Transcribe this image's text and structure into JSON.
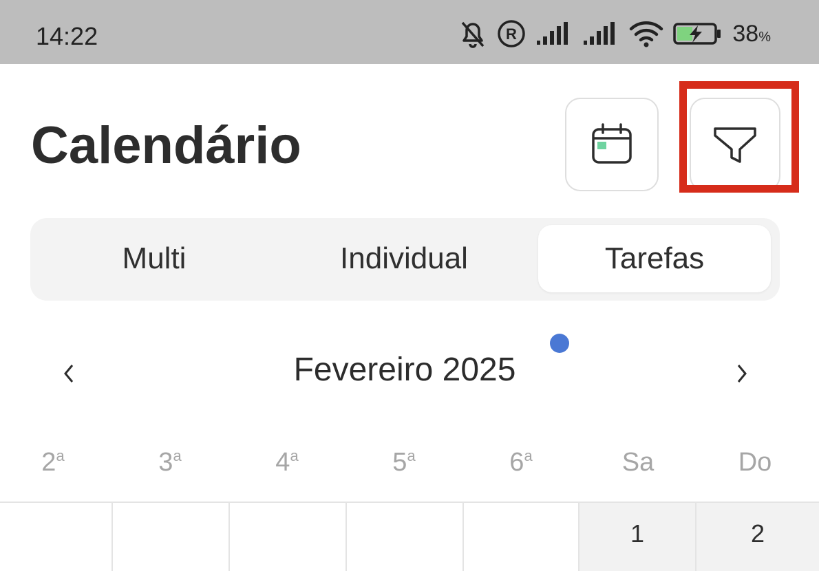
{
  "status_bar": {
    "time": "14:22",
    "battery_percent": "38",
    "battery_unit": "%",
    "icons": [
      "bell-off-icon",
      "registered-icon",
      "signal-icon",
      "signal-icon",
      "wifi-icon",
      "battery-charging-icon"
    ]
  },
  "header": {
    "title": "Calendário",
    "calendar_button_icon": "calendar-icon",
    "filter_button_icon": "filter-icon",
    "highlight_color": "#d62c1a"
  },
  "tabs": [
    {
      "label": "Multi",
      "selected": false
    },
    {
      "label": "Individual",
      "selected": false
    },
    {
      "label": "Tarefas",
      "selected": true
    }
  ],
  "month_nav": {
    "title": "Fevereiro 2025",
    "prev_icon": "chevron-left-icon",
    "next_icon": "chevron-right-icon",
    "indicator_color": "#4a78d4"
  },
  "weekdays": [
    {
      "base": "2",
      "sup": "a"
    },
    {
      "base": "3",
      "sup": "a"
    },
    {
      "base": "4",
      "sup": "a"
    },
    {
      "base": "5",
      "sup": "a"
    },
    {
      "base": "6",
      "sup": "a"
    },
    {
      "base": "Sa",
      "sup": ""
    },
    {
      "base": "Do",
      "sup": ""
    }
  ],
  "first_week": [
    "",
    "",
    "",
    "",
    "",
    "1",
    "2"
  ]
}
